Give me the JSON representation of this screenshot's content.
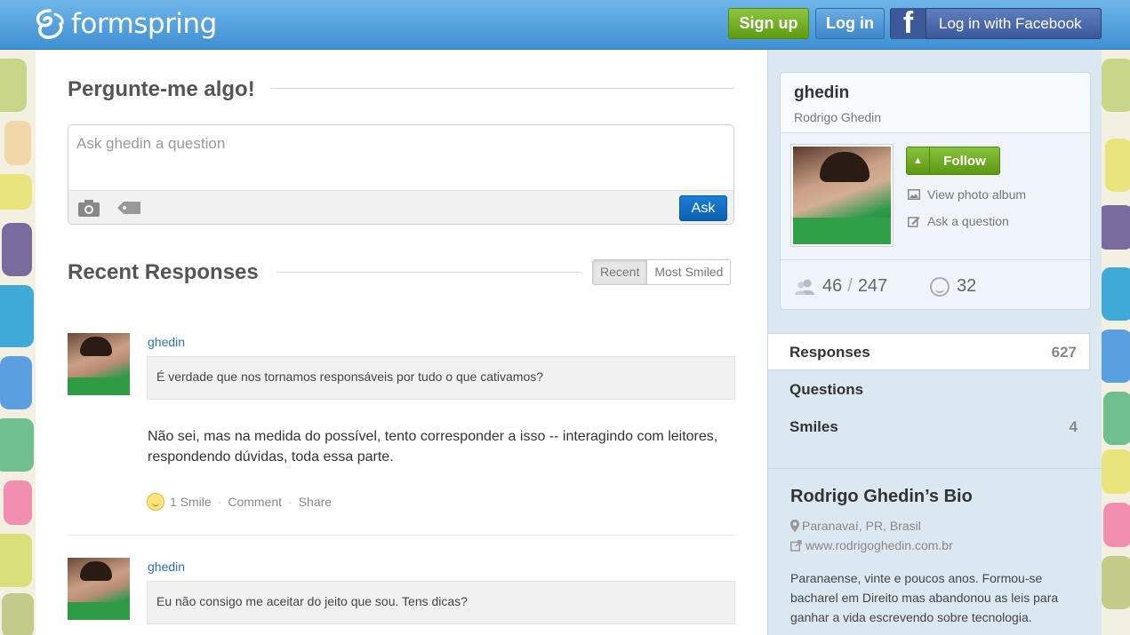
{
  "header": {
    "logo_text": "formspring",
    "signup_label": "Sign up",
    "login_label": "Log in",
    "facebook_label": "Log in with Facebook"
  },
  "ask": {
    "title": "Pergunte-me algo!",
    "placeholder": "Ask ghedin a question",
    "ask_label": "Ask"
  },
  "recent": {
    "title": "Recent Responses",
    "tabs": [
      "Recent",
      "Most Smiled"
    ],
    "responses": [
      {
        "user": "ghedin",
        "question": "É verdade que nos tornamos responsáveis por tudo o que cativamos?",
        "answer": "Não sei, mas na medida do possível, tento corresponder a isso -- interagindo com leitores, respondendo dúvidas, toda essa parte.",
        "smiles": "1 Smile",
        "comment": "Comment",
        "share": "Share"
      },
      {
        "user": "ghedin",
        "question": "Eu não consigo me aceitar do jeito que sou. Tens dicas?"
      }
    ]
  },
  "profile": {
    "username": "ghedin",
    "fullname": "Rodrigo Ghedin",
    "follow_label": "Follow",
    "photo_album_label": "View photo album",
    "ask_question_label": "Ask a question",
    "following": "46",
    "followers": "247",
    "smiles": "32"
  },
  "sidebar_tabs": [
    {
      "label": "Responses",
      "count": "627"
    },
    {
      "label": "Questions",
      "count": ""
    },
    {
      "label": "Smiles",
      "count": "4"
    }
  ],
  "bio": {
    "title": "Rodrigo Ghedin’s Bio",
    "location": "Paranavaí, PR, Brasil",
    "website": "www.rodrigoghedin.com.br",
    "text": "Paranaense, vinte e poucos anos. Formou-se bacharel em Direito mas abandonou as leis para ganhar a vida escrevendo sobre tecnologia."
  },
  "colors": {
    "header_blue": "#3f8fd3",
    "signup_green": "#5e9a12",
    "facebook_blue": "#3b5998",
    "ask_blue": "#0b5fb0",
    "sidebar_bg": "#dce8f1",
    "link_blue": "#2a74b8"
  }
}
